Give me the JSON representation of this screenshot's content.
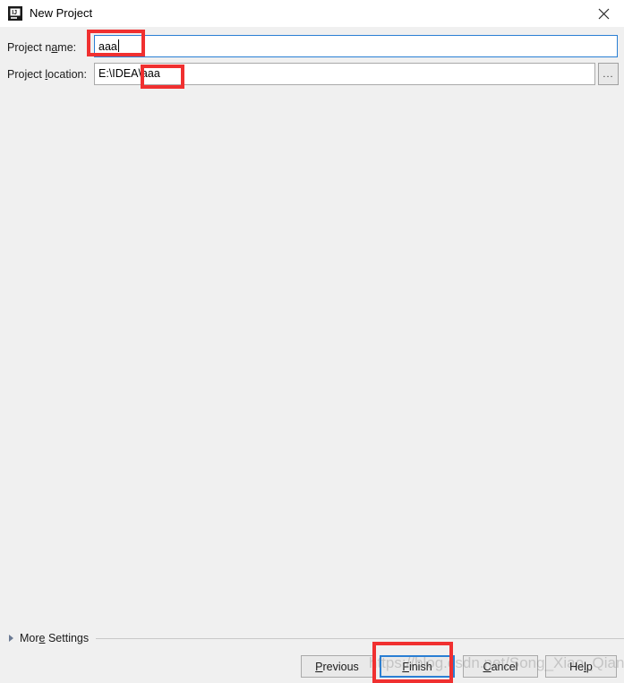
{
  "window": {
    "title": "New Project",
    "app_icon": "intellij-idea-icon",
    "close_icon": "close-icon"
  },
  "form": {
    "project_name": {
      "label_prefix": "Project n",
      "label_mnemonic": "a",
      "label_suffix": "me:",
      "value": "aaa",
      "placeholder": ""
    },
    "project_location": {
      "label_prefix": "Project ",
      "label_mnemonic": "l",
      "label_suffix": "ocation:",
      "value": "E:\\IDEA\\aaa",
      "placeholder": "",
      "browse_label": "...",
      "browse_icon": "ellipsis-icon"
    }
  },
  "more_settings": {
    "label_prefix": "Mor",
    "label_mnemonic": "e",
    "label_suffix": " Settings",
    "expanded": false,
    "disclosure_icon": "triangle-right-icon"
  },
  "buttons": {
    "previous": {
      "prefix": "",
      "mnemonic": "P",
      "suffix": "revious"
    },
    "finish": {
      "prefix": "",
      "mnemonic": "F",
      "suffix": "inish"
    },
    "cancel": {
      "prefix": "",
      "mnemonic": "C",
      "suffix": "ancel"
    },
    "help": {
      "prefix": "He",
      "mnemonic": "l",
      "suffix": "p"
    }
  },
  "watermark": {
    "text": "https://blog.csdn.net/Song_Xiao_Qiang"
  },
  "colors": {
    "focus_border": "#2a7fd4",
    "annotation": "#f03030",
    "dialog_background": "#f0f0f0",
    "titlebar_background": "#ffffff",
    "field_background": "#ffffff",
    "button_background": "#e9e9e9"
  }
}
